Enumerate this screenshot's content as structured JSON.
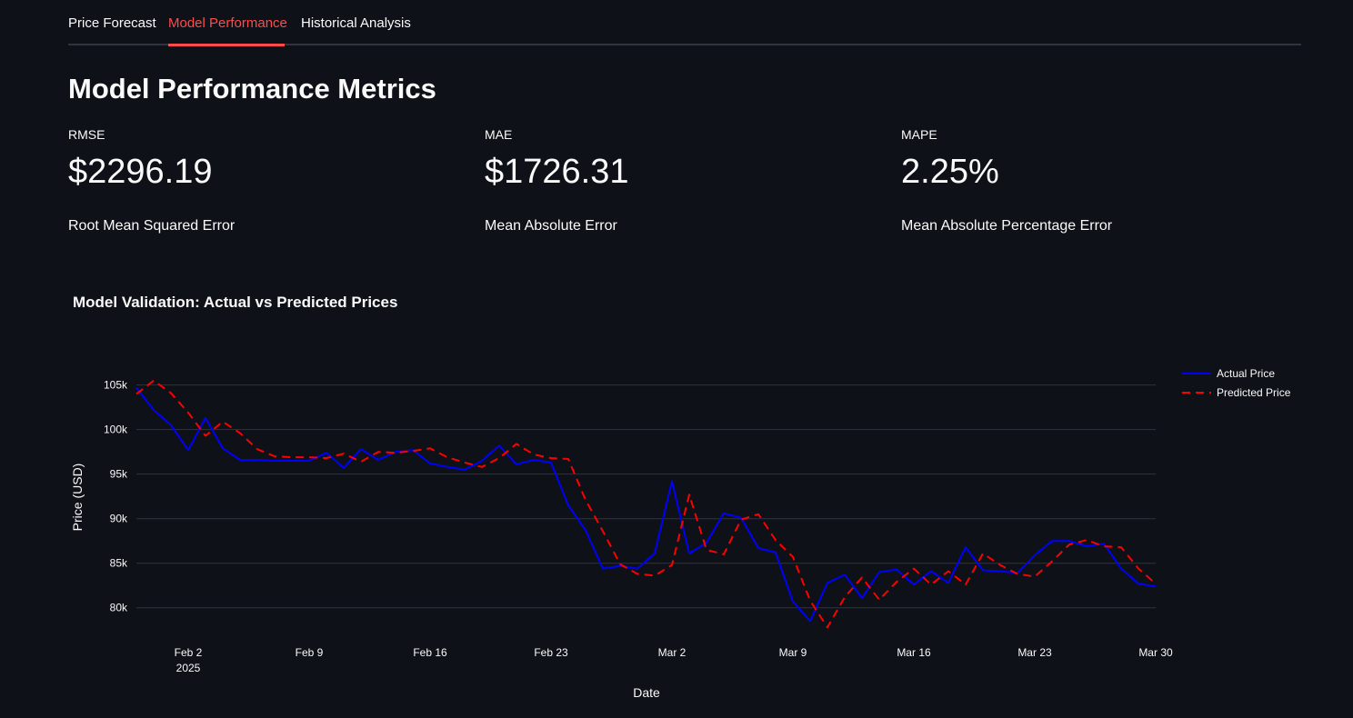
{
  "tabs": [
    {
      "label": "Price Forecast",
      "active": false
    },
    {
      "label": "Model Performance",
      "active": true
    },
    {
      "label": "Historical Analysis",
      "active": false
    }
  ],
  "title": "Model Performance Metrics",
  "metrics": [
    {
      "label": "RMSE",
      "value": "$2296.19",
      "caption": "Root Mean Squared Error"
    },
    {
      "label": "MAE",
      "value": "$1726.31",
      "caption": "Mean Absolute Error"
    },
    {
      "label": "MAPE",
      "value": "2.25%",
      "caption": "Mean Absolute Percentage Error"
    }
  ],
  "colors": {
    "accent": "#ff4b4b",
    "background": "#0e1117",
    "actual": "#0000ff",
    "predicted": "#ff0000"
  },
  "chart_data": {
    "type": "line",
    "title": "Model Validation: Actual vs Predicted Prices",
    "xlabel": "Date",
    "ylabel": "Price (USD)",
    "x_start": "2025-01-30",
    "x_end": "2025-03-30",
    "x_ticks": [
      {
        "date": "2025-02-02",
        "label": "Feb 2",
        "sublabel": "2025"
      },
      {
        "date": "2025-02-09",
        "label": "Feb 9"
      },
      {
        "date": "2025-02-16",
        "label": "Feb 16"
      },
      {
        "date": "2025-02-23",
        "label": "Feb 23"
      },
      {
        "date": "2025-03-02",
        "label": "Mar 2"
      },
      {
        "date": "2025-03-09",
        "label": "Mar 9"
      },
      {
        "date": "2025-03-16",
        "label": "Mar 16"
      },
      {
        "date": "2025-03-23",
        "label": "Mar 23"
      },
      {
        "date": "2025-03-30",
        "label": "Mar 30"
      }
    ],
    "y_ticks": [
      {
        "value": 80000,
        "label": "80k"
      },
      {
        "value": 85000,
        "label": "85k"
      },
      {
        "value": 90000,
        "label": "90k"
      },
      {
        "value": 95000,
        "label": "95k"
      },
      {
        "value": 100000,
        "label": "100k"
      },
      {
        "value": 105000,
        "label": "105k"
      }
    ],
    "ylim": [
      76400,
      106700
    ],
    "grid": true,
    "legend_position": "top-right",
    "series": [
      {
        "name": "Actual Price",
        "color": "#0000ff",
        "style": "solid",
        "values": [
          104700,
          102200,
          100500,
          97700,
          101300,
          97900,
          96600,
          96600,
          96500,
          96500,
          96500,
          97400,
          95700,
          97800,
          96600,
          97500,
          97700,
          96200,
          95800,
          95500,
          96500,
          98200,
          96100,
          96600,
          96300,
          91500,
          88700,
          84400,
          84700,
          84400,
          86100,
          94200,
          86100,
          87300,
          90600,
          90100,
          86700,
          86200,
          80700,
          78500,
          82800,
          83700,
          81100,
          84000,
          84300,
          82600,
          84100,
          82800,
          86800,
          84200,
          84100,
          83900,
          85900,
          87500,
          87500,
          86900,
          87200,
          84400,
          82700,
          82400
        ]
      },
      {
        "name": "Predicted Price",
        "color": "#ff0000",
        "style": "dashed",
        "values": [
          104000,
          105500,
          104100,
          101900,
          99300,
          100900,
          99600,
          97800,
          97000,
          96900,
          96900,
          96800,
          97300,
          96400,
          97500,
          97400,
          97600,
          97900,
          96900,
          96300,
          95800,
          96800,
          98400,
          97200,
          96800,
          96700,
          92100,
          88600,
          84900,
          83800,
          83600,
          84800,
          92700,
          86500,
          86000,
          89900,
          90500,
          87600,
          85700,
          80800,
          77800,
          81200,
          83400,
          80900,
          82900,
          84400,
          82600,
          84100,
          82600,
          86100,
          84800,
          83800,
          83500,
          85200,
          87100,
          87600,
          86900,
          86800,
          84400,
          82700
        ]
      }
    ]
  }
}
